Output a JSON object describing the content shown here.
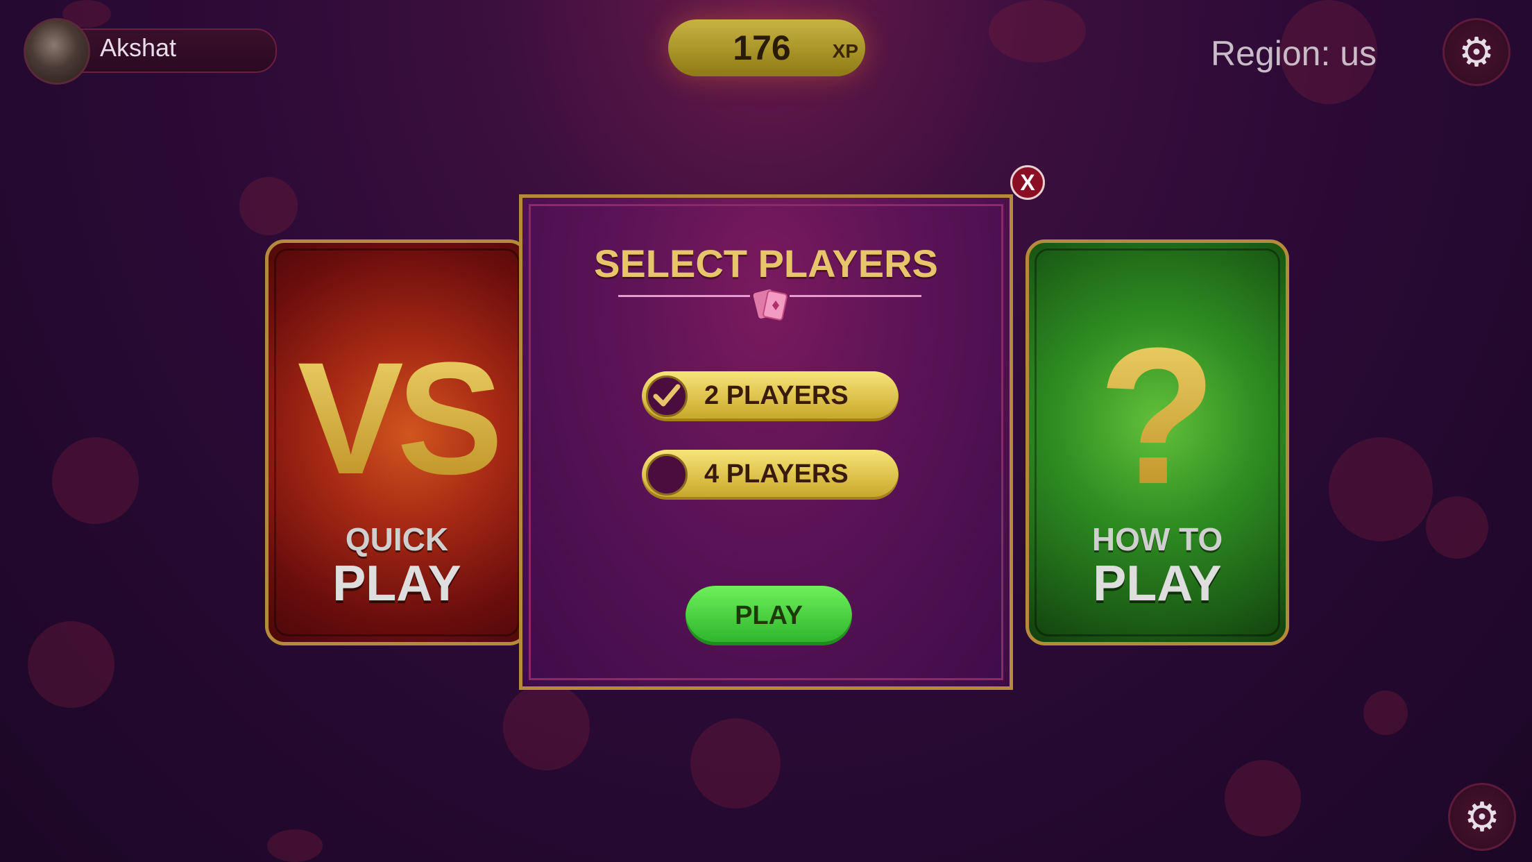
{
  "user": {
    "name": "Akshat"
  },
  "xp": {
    "value": "176",
    "label": "XP"
  },
  "region": {
    "text": "Region: us"
  },
  "cards": {
    "quick_play": {
      "symbol": "VS",
      "line1": "QUICK",
      "line2": "PLAY"
    },
    "how_to_play": {
      "symbol": "?",
      "line1": "HOW TO",
      "line2": "PLAY"
    }
  },
  "modal": {
    "title": "SELECT PLAYERS",
    "options": [
      {
        "label": "2 PLAYERS",
        "selected": true
      },
      {
        "label": "4 PLAYERS",
        "selected": false
      }
    ],
    "play_label": "PLAY",
    "close_label": "X"
  },
  "icons": {
    "settings": "gear-icon",
    "settings_secondary": "gear-icon",
    "cards": "playing-cards-icon",
    "check": "checkmark-icon"
  },
  "colors": {
    "gold": "#e7c56a",
    "modal_bg": "#5a1356",
    "play_green": "#3fd03a",
    "quick_play_red": "#a82a14",
    "how_to_green": "#2f8e22"
  }
}
